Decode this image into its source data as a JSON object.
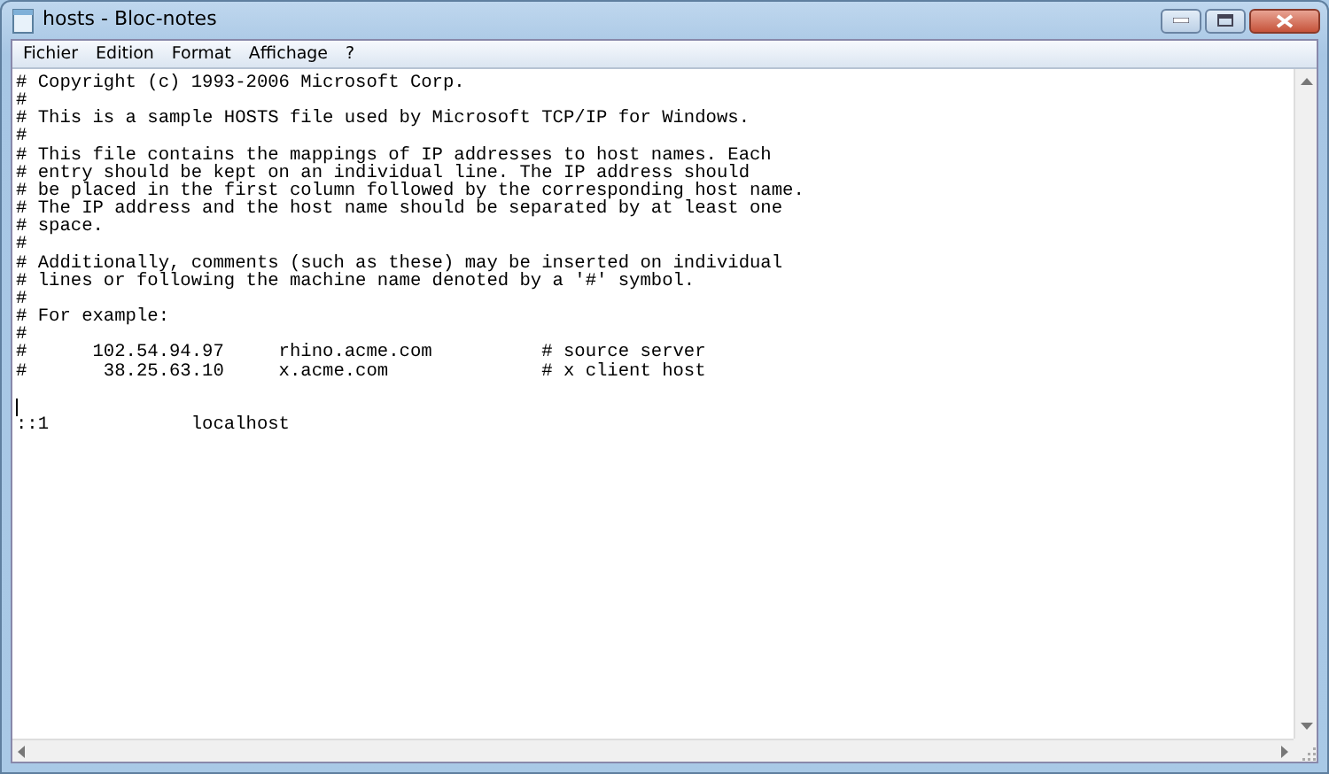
{
  "window": {
    "title": "hosts - Bloc-notes"
  },
  "menu": [
    "Fichier",
    "Edition",
    "Format",
    "Affichage",
    "?"
  ],
  "editor": {
    "text_before_cursor": "# Copyright (c) 1993-2006 Microsoft Corp.\n#\n# This is a sample HOSTS file used by Microsoft TCP/IP for Windows.\n#\n# This file contains the mappings of IP addresses to host names. Each\n# entry should be kept on an individual line. The IP address should\n# be placed in the first column followed by the corresponding host name.\n# The IP address and the host name should be separated by at least one\n# space.\n#\n# Additionally, comments (such as these) may be inserted on individual\n# lines or following the machine name denoted by a '#' symbol.\n#\n# For example:\n#\n#      102.54.94.97     rhino.acme.com          # source server\n#       38.25.63.10     x.acme.com              # x client host\n\n",
    "text_after_cursor": "\n::1             localhost"
  }
}
